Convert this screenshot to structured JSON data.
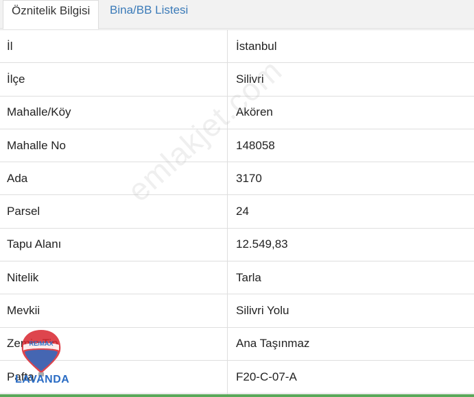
{
  "tabs": [
    {
      "label": "Öznitelik Bilgisi",
      "active": true
    },
    {
      "label": "Bina/BB Listesi",
      "active": false
    }
  ],
  "rows": [
    {
      "label": "İl",
      "value": "İstanbul"
    },
    {
      "label": "İlçe",
      "value": "Silivri"
    },
    {
      "label": "Mahalle/Köy",
      "value": "Akören"
    },
    {
      "label": "Mahalle No",
      "value": "148058"
    },
    {
      "label": "Ada",
      "value": "3170"
    },
    {
      "label": "Parsel",
      "value": "24"
    },
    {
      "label": "Tapu Alanı",
      "value": "12.549,83"
    },
    {
      "label": "Nitelik",
      "value": "Tarla"
    },
    {
      "label": "Mevkii",
      "value": "Silivri Yolu"
    },
    {
      "label": "Zemin Tip",
      "value": "Ana Taşınmaz"
    },
    {
      "label": "Pafta",
      "value": "F20-C-07-A"
    }
  ],
  "watermark": "emlakjet.com",
  "logo": {
    "top_text": "RE/MAX",
    "bottom_text": "LAVANDA"
  },
  "colors": {
    "tab_link": "#3a7ab8",
    "accent_bar": "#5aa85a",
    "logo_blue": "#2a6cc4",
    "logo_red": "#d8252e"
  }
}
